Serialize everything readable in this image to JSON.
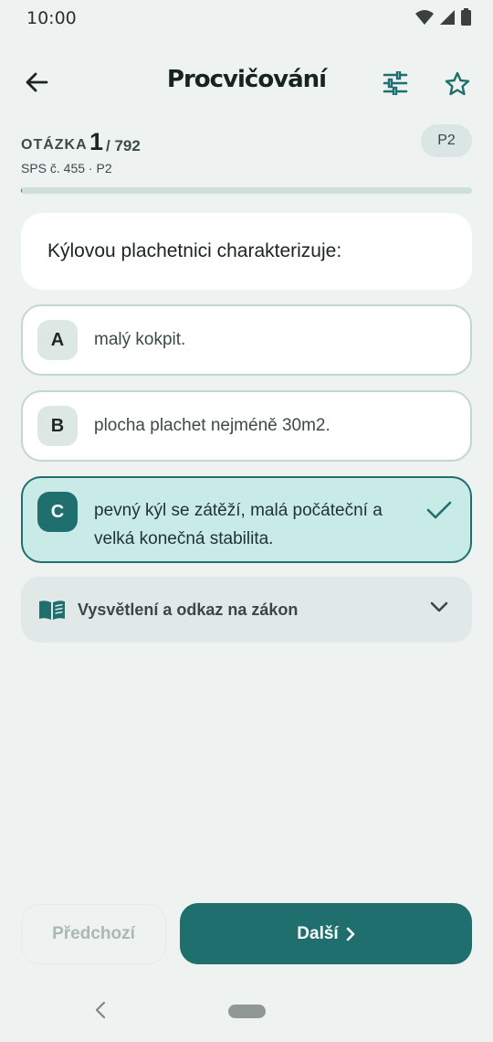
{
  "status_bar": {
    "time": "10:00"
  },
  "app_bar": {
    "title": "Procvičování"
  },
  "question": {
    "label": "OTÁZKA",
    "number": "1",
    "total": "/ 792",
    "source": "SPS č. 455 · P2",
    "level_badge": "P2",
    "progress_percent": 0.13,
    "text": "Kýlovou plachetnici charakterizuje:"
  },
  "answers": [
    {
      "letter": "A",
      "text": "malý kokpit.",
      "selected": false
    },
    {
      "letter": "B",
      "text": "plocha plachet nejméně 30m2.",
      "selected": false
    },
    {
      "letter": "C",
      "text_line1": "pevný kýl se zátěží, malá počáteční a",
      "text_line2": "velká konečná stabilita.",
      "selected": true
    }
  ],
  "explanation": {
    "label": "Vysvětlení a odkaz na zákon"
  },
  "navigation": {
    "prev_label": "Předchozí",
    "next_label": "Další"
  },
  "colors": {
    "accent": "#1f6f6e",
    "selected_bg": "#c9ebe8",
    "background": "#eef3f2"
  }
}
